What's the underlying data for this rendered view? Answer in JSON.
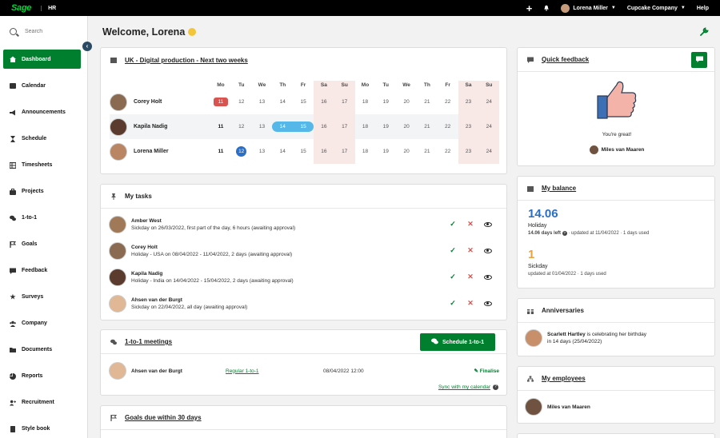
{
  "topbar": {
    "logo": "Sage",
    "app": "HR",
    "user": "Lorena Miller",
    "company": "Cupcake Company",
    "help": "Help"
  },
  "sidebar": {
    "search_placeholder": "Search",
    "items": [
      {
        "label": "Dashboard",
        "icon": "dashboard-icon",
        "active": true
      },
      {
        "label": "Calendar",
        "icon": "calendar-icon"
      },
      {
        "label": "Announcements",
        "icon": "megaphone-icon"
      },
      {
        "label": "Schedule",
        "icon": "hourglass-icon"
      },
      {
        "label": "Timesheets",
        "icon": "table-icon"
      },
      {
        "label": "Projects",
        "icon": "briefcase-icon"
      },
      {
        "label": "1-to-1",
        "icon": "chat-icon"
      },
      {
        "label": "Goals",
        "icon": "flag-icon"
      },
      {
        "label": "Feedback",
        "icon": "feedback-icon"
      },
      {
        "label": "Surveys",
        "icon": "star-icon"
      },
      {
        "label": "Company",
        "icon": "people-icon"
      },
      {
        "label": "Documents",
        "icon": "folder-icon"
      },
      {
        "label": "Reports",
        "icon": "pie-chart-icon"
      },
      {
        "label": "Recruitment",
        "icon": "add-user-icon"
      },
      {
        "label": "Style book",
        "icon": "book-icon"
      }
    ]
  },
  "welcome": "Welcome, Lorena",
  "calendar": {
    "title": "UK - Digital production - Next two weeks",
    "days": [
      "Mo",
      "Tu",
      "We",
      "Th",
      "Fr",
      "Sa",
      "Su",
      "Mo",
      "Tu",
      "We",
      "Th",
      "Fr",
      "Sa",
      "Su"
    ],
    "people": [
      {
        "name": "Corey Holt",
        "dates": [
          "11",
          "12",
          "13",
          "14",
          "15",
          "16",
          "17",
          "18",
          "19",
          "20",
          "21",
          "22",
          "23",
          "24"
        ]
      },
      {
        "name": "Kapila Nadig",
        "dates": [
          "11",
          "12",
          "13",
          "14",
          "15",
          "16",
          "17",
          "18",
          "19",
          "20",
          "21",
          "22",
          "23",
          "24"
        ]
      },
      {
        "name": "Lorena Miller",
        "dates": [
          "11",
          "12",
          "13",
          "14",
          "15",
          "16",
          "17",
          "18",
          "19",
          "20",
          "21",
          "22",
          "23",
          "24"
        ]
      }
    ]
  },
  "tasks": {
    "title": "My tasks",
    "items": [
      {
        "name": "Amber West",
        "desc": "Sickday on 26/03/2022, first part of the day, 6 hours (awaiting approval)"
      },
      {
        "name": "Corey Holt",
        "desc": "Holiday - USA on 08/04/2022 - 11/04/2022, 2 days (awaiting approval)"
      },
      {
        "name": "Kapila Nadig",
        "desc": "Holiday - India on 14/04/2022 - 15/04/2022, 2 days (awaiting approval)"
      },
      {
        "name": "Ahsen van der Burgt",
        "desc": "Sickday on 22/04/2022, all day (awaiting approval)"
      }
    ]
  },
  "meetings": {
    "title": "1-to-1 meetings",
    "button": "Schedule 1-to-1",
    "row": {
      "name": "Ahsen van der Burgt",
      "type": "Regular 1-to-1",
      "date": "08/04/2022 12:00",
      "action": "Finalise"
    },
    "sync": "Sync with my calendar"
  },
  "goals": {
    "title": "Goals due within 30 days"
  },
  "feedback": {
    "title": "Quick feedback",
    "message": "You're great!",
    "from": "Miles van Maaren"
  },
  "balance": {
    "title": "My balance",
    "holiday_value": "14.06",
    "holiday_label": "Holiday",
    "holiday_left": "14.06 days left",
    "holiday_updated": "· updated at 11/04/2022 · 1 days used",
    "sick_value": "1",
    "sick_label": "Sickday",
    "sick_updated": "updated at 01/04/2022 · 1 days used"
  },
  "anniversaries": {
    "title": "Anniversaries",
    "name": "Scarlett Hartley",
    "text": "is celebrating her birthday",
    "when": "in 14 days (25/04/2022)"
  },
  "employees": {
    "title": "My employees",
    "name": "Miles van Maaren"
  },
  "colors": {
    "accent": "#00802f",
    "brand": "#00d639",
    "blue": "#2a6ec6",
    "red": "#d9534f"
  }
}
